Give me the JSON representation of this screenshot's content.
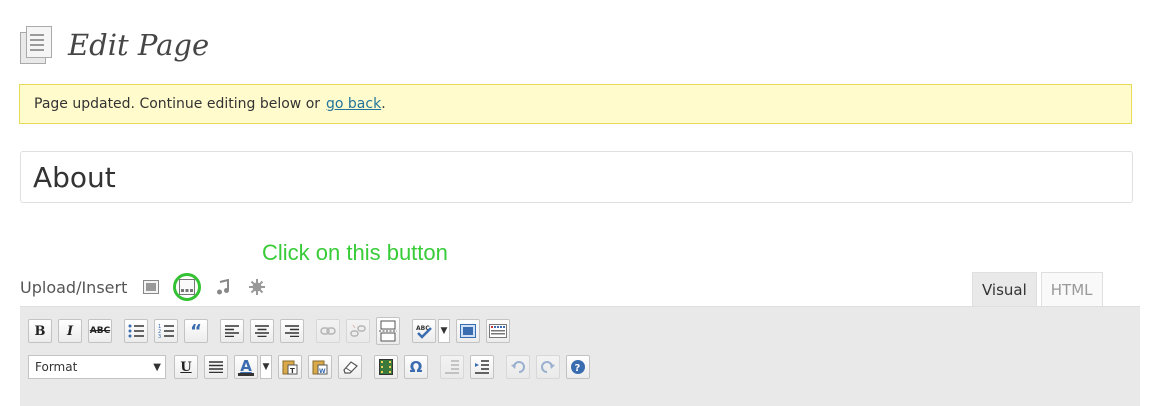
{
  "header": {
    "title": "Edit Page"
  },
  "notice": {
    "text": "Page updated. Continue editing below or",
    "link": "go back",
    "end": "."
  },
  "post_title": {
    "value": "About"
  },
  "annotation": {
    "text": "Click on this button",
    "color": "#38cc38"
  },
  "media": {
    "label": "Upload/Insert"
  },
  "editor_tabs": [
    {
      "label": "Visual"
    },
    {
      "label": "HTML"
    }
  ],
  "toolbar": {
    "bold": "B",
    "italic": "I",
    "strike": "ABC",
    "quote": "“",
    "format_value": "Format",
    "underline": "U",
    "forecolor": "A",
    "special_char": "Ω"
  }
}
